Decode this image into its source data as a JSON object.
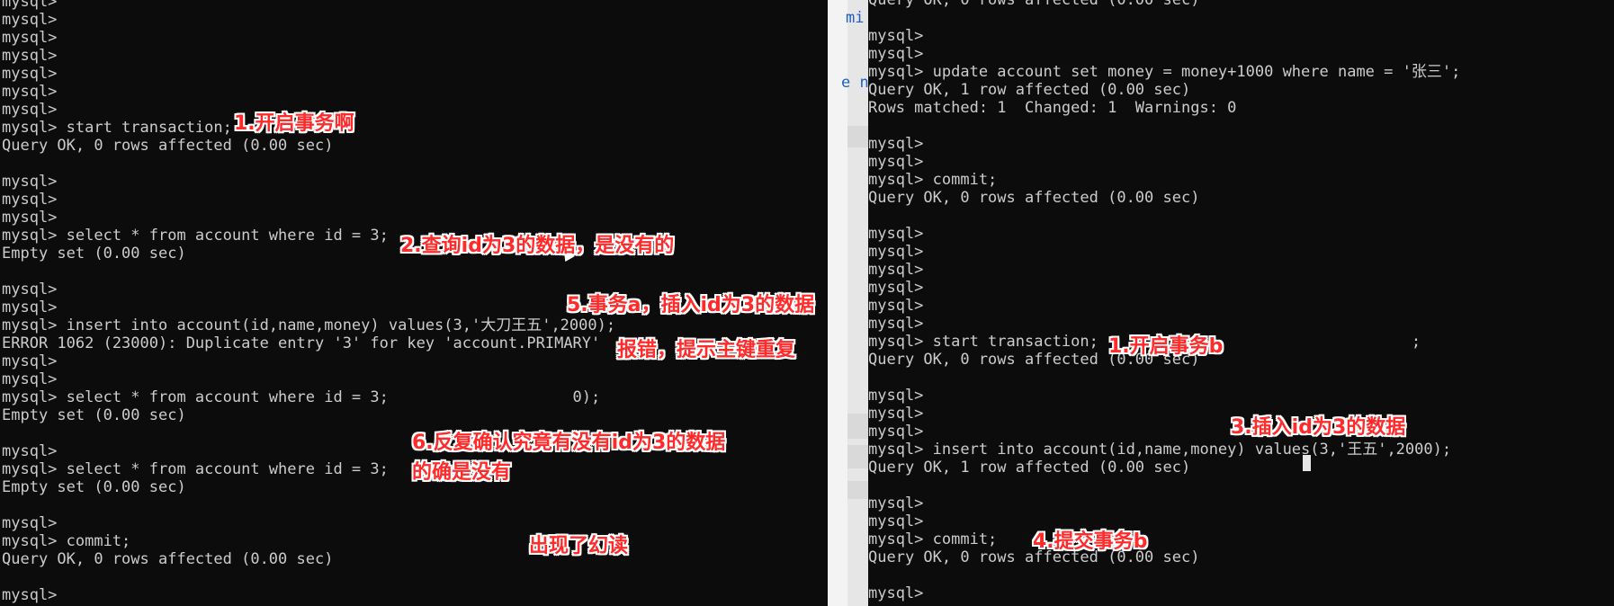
{
  "terminal_a": {
    "lines": [
      "mysql>",
      "mysql>",
      "mysql>",
      "mysql>",
      "mysql>",
      "mysql>",
      "mysql>",
      "mysql> start transaction;",
      "Query OK, 0 rows affected (0.00 sec)",
      "",
      "mysql>",
      "mysql>",
      "mysql>",
      "mysql> select * from account where id = 3;",
      "Empty set (0.00 sec)",
      "",
      "mysql>",
      "mysql>",
      "mysql> insert into account(id,name,money) values(3,'大刀王五',2000);",
      "ERROR 1062 (23000): Duplicate entry '3' for key 'account.PRIMARY'",
      "mysql>",
      "mysql>",
      "mysql> select * from account where id = 3;                    0);",
      "Empty set (0.00 sec)",
      "",
      "mysql>",
      "mysql> select * from account where id = 3;",
      "Empty set (0.00 sec)",
      "",
      "mysql>",
      "mysql> commit;",
      "Query OK, 0 rows affected (0.00 sec)",
      "",
      "mysql>"
    ]
  },
  "terminal_b": {
    "lines": [
      "Query OK, 0 rows affected (0.00 sec)",
      "",
      "mysql>",
      "mysql>",
      "mysql> update account set money = money+1000 where name = '张三';",
      "Query OK, 1 row affected (0.00 sec)",
      "Rows matched: 1  Changed: 1  Warnings: 0",
      "",
      "mysql>",
      "mysql>",
      "mysql> commit;",
      "Query OK, 0 rows affected (0.00 sec)",
      "",
      "mysql>",
      "mysql>",
      "mysql>",
      "mysql>",
      "mysql>",
      "mysql>",
      "mysql> start transaction;                                  ;",
      "Query OK, 0 rows affected (0.00 sec)",
      "",
      "mysql>",
      "mysql>",
      "mysql>",
      "mysql> insert into account(id,name,money) values(3,'王五',2000);",
      "Query OK, 1 row affected (0.00 sec)",
      "",
      "mysql>",
      "mysql>",
      "mysql> commit;",
      "Query OK, 0 rows affected (0.00 sec)",
      "",
      "mysql>"
    ]
  },
  "editor_fragments": [
    "mi",
    "e n"
  ],
  "annotations": {
    "a1": "1.开启事务啊",
    "a2": "2.查询id为3的数据，是没有的",
    "a5": "5.事务a，插入id为3的数据",
    "a5b": "报错，提示主键重复",
    "a6": "6.反复确认究竟有没有id为3的数据",
    "a6b": "的确是没有",
    "phantom": "出现了幻读",
    "b1": "1.开启事务b",
    "b3": "3.插入id为3的数据",
    "b4": "4.提交事务b"
  },
  "colors": {
    "terminal_bg": "#0c0c0c",
    "terminal_text": "#cccccc",
    "annotation": "#ff2a2a"
  }
}
